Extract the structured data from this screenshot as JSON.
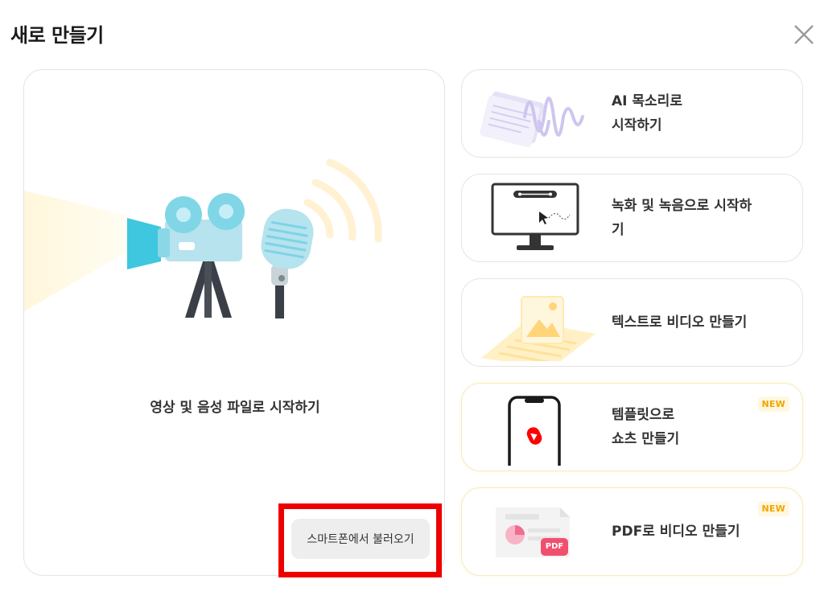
{
  "dialog": {
    "title": "새로 만들기",
    "close_icon": "close-icon"
  },
  "main_option": {
    "label": "영상 및 음성 파일로 시작하기",
    "illustration": "camera-and-microphone-icon",
    "phone_import_label": "스마트폰에서 불러오기"
  },
  "options": [
    {
      "label": "AI 목소리로\n시작하기",
      "icon": "ai-voice-waveform-icon",
      "new": ""
    },
    {
      "label": "녹화 및 녹음으로 시작하\n기",
      "icon": "screen-recording-monitor-icon",
      "new": ""
    },
    {
      "label": "텍스트로 비디오 만들기",
      "icon": "text-to-video-icon",
      "new": ""
    },
    {
      "label": "템플릿으로\n쇼츠 만들기",
      "icon": "shorts-phone-icon",
      "new": "NEW"
    },
    {
      "label": "PDF로 비디오 만들기",
      "icon": "pdf-document-icon",
      "new": "NEW"
    }
  ],
  "pdf_tag": "PDF",
  "colors": {
    "highlight": "#ee0000",
    "new_badge": "#f2a500",
    "camera_teal": "#7fd3e6",
    "youtube_red": "#ff0000"
  }
}
